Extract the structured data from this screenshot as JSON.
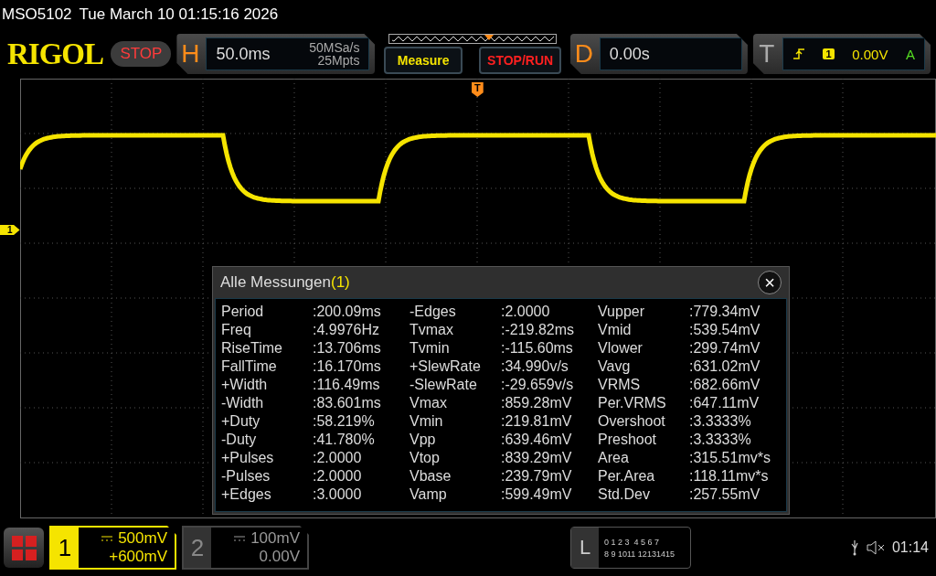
{
  "header": {
    "model": "MSO5102",
    "datetime": "Tue March 10 01:15:16 2026"
  },
  "toolbar": {
    "logo": "RIGOL",
    "run_state": "STOP",
    "horizontal": {
      "label": "H",
      "timebase": "50.0ms",
      "sample_rate": "50MSa/s",
      "memory_depth": "25Mpts"
    },
    "buttons": [
      {
        "label": "Measure",
        "kind": "measure"
      },
      {
        "label": "STOP/RUN",
        "kind": "run"
      }
    ],
    "delay": {
      "label": "D",
      "value": "0.00s"
    },
    "trigger": {
      "label": "T",
      "source": "1",
      "level": "0.00V",
      "mode": "A"
    }
  },
  "screen": {
    "trigger_marker": "T",
    "channel_marker": "1",
    "dialog": {
      "title": "Alle Messungen",
      "channel": "(1)",
      "close": "×",
      "columns": [
        [
          {
            "name": "Period",
            "value": ":200.09ms"
          },
          {
            "name": "Freq",
            "value": ":4.9976Hz"
          },
          {
            "name": "RiseTime",
            "value": ":13.706ms"
          },
          {
            "name": "FallTime",
            "value": ":16.170ms"
          },
          {
            "name": "+Width",
            "value": ":116.49ms"
          },
          {
            "name": "-Width",
            "value": ":83.601ms"
          },
          {
            "name": "+Duty",
            "value": ":58.219%"
          },
          {
            "name": "-Duty",
            "value": ":41.780%"
          },
          {
            "name": "+Pulses",
            "value": ":2.0000"
          },
          {
            "name": "-Pulses",
            "value": ":2.0000"
          },
          {
            "name": "+Edges",
            "value": ":3.0000"
          }
        ],
        [
          {
            "name": "-Edges",
            "value": ":2.0000"
          },
          {
            "name": "Tvmax",
            "value": ":-219.82ms"
          },
          {
            "name": "Tvmin",
            "value": ":-115.60ms"
          },
          {
            "name": "+SlewRate",
            "value": ":34.990v/s"
          },
          {
            "name": "-SlewRate",
            "value": ":-29.659v/s"
          },
          {
            "name": "Vmax",
            "value": ":859.28mV"
          },
          {
            "name": "Vmin",
            "value": ":219.81mV"
          },
          {
            "name": "Vpp",
            "value": ":639.46mV"
          },
          {
            "name": "Vtop",
            "value": ":839.29mV"
          },
          {
            "name": "Vbase",
            "value": ":239.79mV"
          },
          {
            "name": "Vamp",
            "value": ":599.49mV"
          }
        ],
        [
          {
            "name": "Vupper",
            "value": ":779.34mV"
          },
          {
            "name": "Vmid",
            "value": ":539.54mV"
          },
          {
            "name": "Vlower",
            "value": ":299.74mV"
          },
          {
            "name": "Vavg",
            "value": ":631.02mV"
          },
          {
            "name": "VRMS",
            "value": ":682.66mV"
          },
          {
            "name": "Per.VRMS",
            "value": ":647.11mV"
          },
          {
            "name": "Overshoot",
            "value": ":3.3333%"
          },
          {
            "name": "Preshoot",
            "value": ":3.3333%"
          },
          {
            "name": "Area",
            "value": ":315.51mv*s"
          },
          {
            "name": "Per.Area",
            "value": ":118.11mv*s"
          },
          {
            "name": "Std.Dev",
            "value": ":257.55mV"
          }
        ]
      ]
    }
  },
  "bottom": {
    "channels": [
      {
        "number": "1",
        "scale": "500mV",
        "offset": "+600mV",
        "selected": true
      },
      {
        "number": "2",
        "scale": "100mV",
        "offset": "0.00V",
        "selected": false
      }
    ],
    "logic": {
      "label": "L",
      "row_1": "0 1 2 3  4 5 6 7",
      "row_2": "8 9 1011 12131415"
    },
    "time": "01:14"
  }
}
